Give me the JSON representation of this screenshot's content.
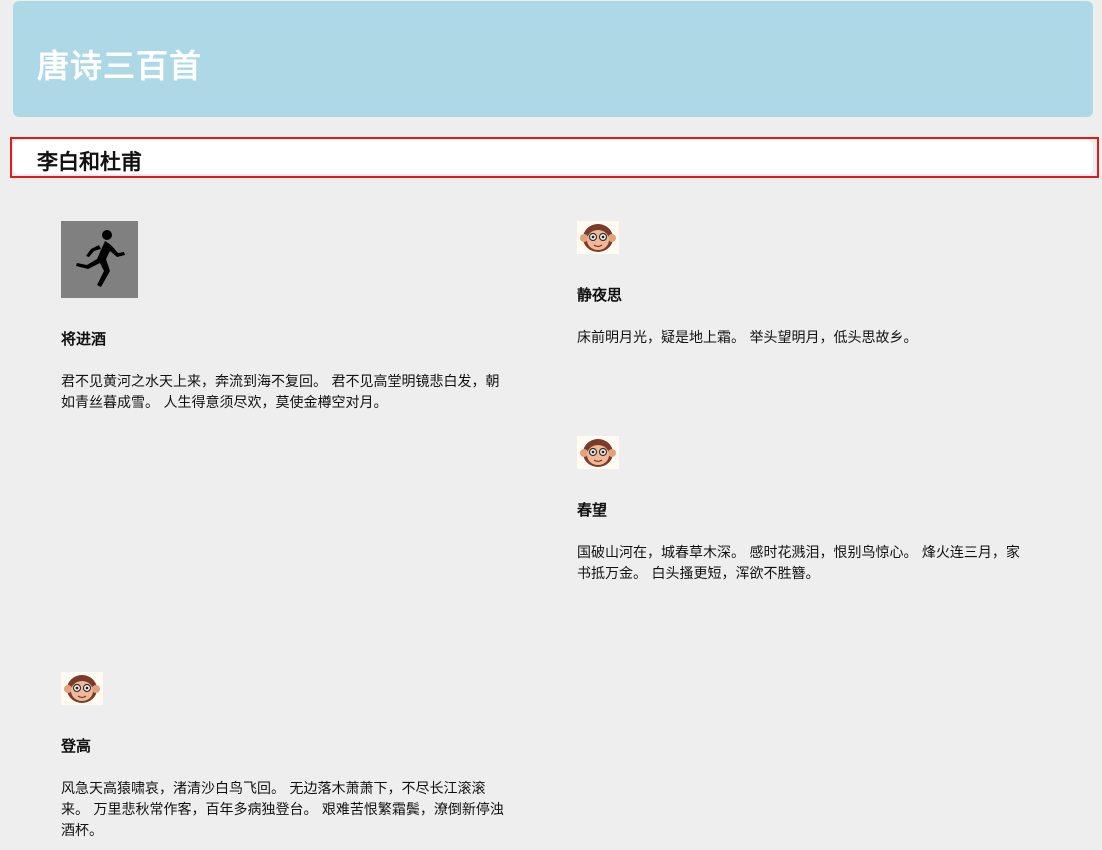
{
  "header": {
    "title": "唐诗三百首",
    "background": "#add8e6"
  },
  "subheader": {
    "title": "李白和杜甫",
    "outline_color": "#e01b1b"
  },
  "poems": [
    {
      "thumbnail": "runner-icon",
      "title": "将进酒",
      "text": "君不见黄河之水天上来，奔流到海不复回。 君不见高堂明镜悲白发，朝如青丝暮成雪。 人生得意须尽欢，莫使金樽空对月。"
    },
    {
      "thumbnail": "monkey-icon",
      "title": "静夜思",
      "text": "床前明月光，疑是地上霜。 举头望明月，低头思故乡。"
    },
    {
      "thumbnail": "monkey-icon",
      "title": "春望",
      "text": "国破山河在，城春草木深。 感时花溅泪，恨别鸟惊心。 烽火连三月，家书抵万金。 白头搔更短，浑欲不胜簪。"
    },
    {
      "thumbnail": "monkey-icon",
      "title": "登高",
      "text": "风急天高猿啸哀，渚清沙白鸟飞回。 无边落木萧萧下，不尽长江滚滚来。 万里悲秋常作客，百年多病独登台。 艰难苦恨繁霜鬓，潦倒新停浊酒杯。"
    }
  ]
}
